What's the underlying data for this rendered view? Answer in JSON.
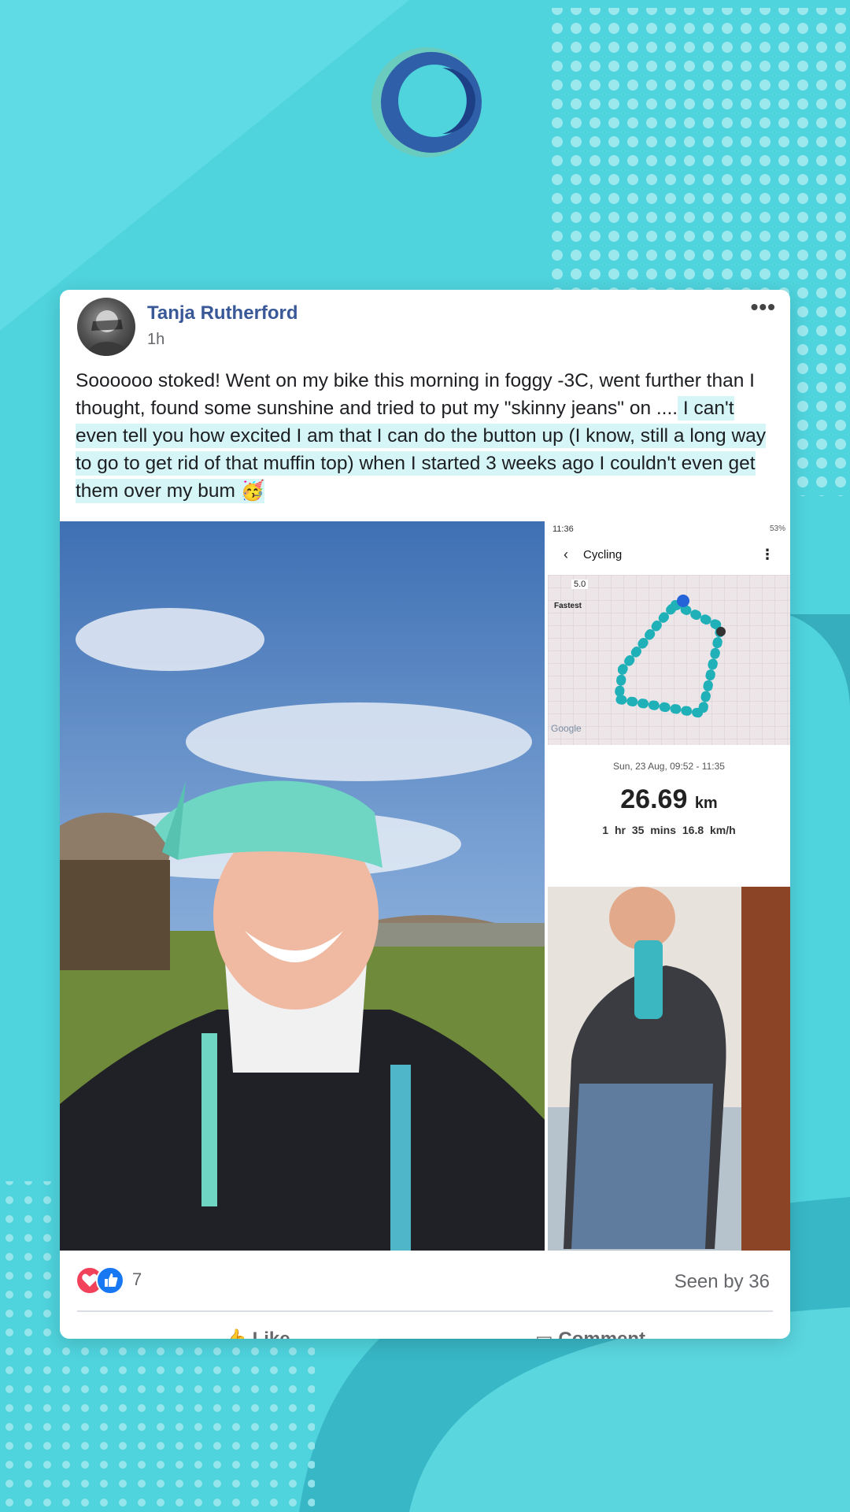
{
  "post": {
    "author": "Tanja Rutherford",
    "time": "1h",
    "more": "•••",
    "text_plain": "Soooooo stoked! Went on my bike this morning in foggy -3C, went further than I thought, found some sunshine and tried to put my \"skinny jeans\" on ....",
    "text_highlight": " I can't even tell you how excited I am that I can do the button up (I know, still a long way to go to get rid of that muffin top) when I started 3 weeks ago I couldn't even get them over my bum",
    "emoji": "🥳"
  },
  "app_screenshot": {
    "status_time": "11:36",
    "status_right": "53%",
    "title": "Cycling",
    "speed_label": "5.0",
    "legend_label": "Fastest",
    "map_brand": "Google",
    "date": "Sun, 23 Aug, 09:52 - 11:35",
    "distance": "26.69",
    "distance_unit": "km",
    "duration": "1 hr 35 mins",
    "speed": "16.8 km/h"
  },
  "reactions": {
    "count": "7",
    "seen": "Seen by 36"
  },
  "actions": {
    "like": "Like",
    "comment": "Comment"
  },
  "colors": {
    "background": "#4fd3dd",
    "author_link": "#385898",
    "highlight": "#d6f5f7",
    "love": "#f2415a",
    "like": "#1877f2"
  }
}
